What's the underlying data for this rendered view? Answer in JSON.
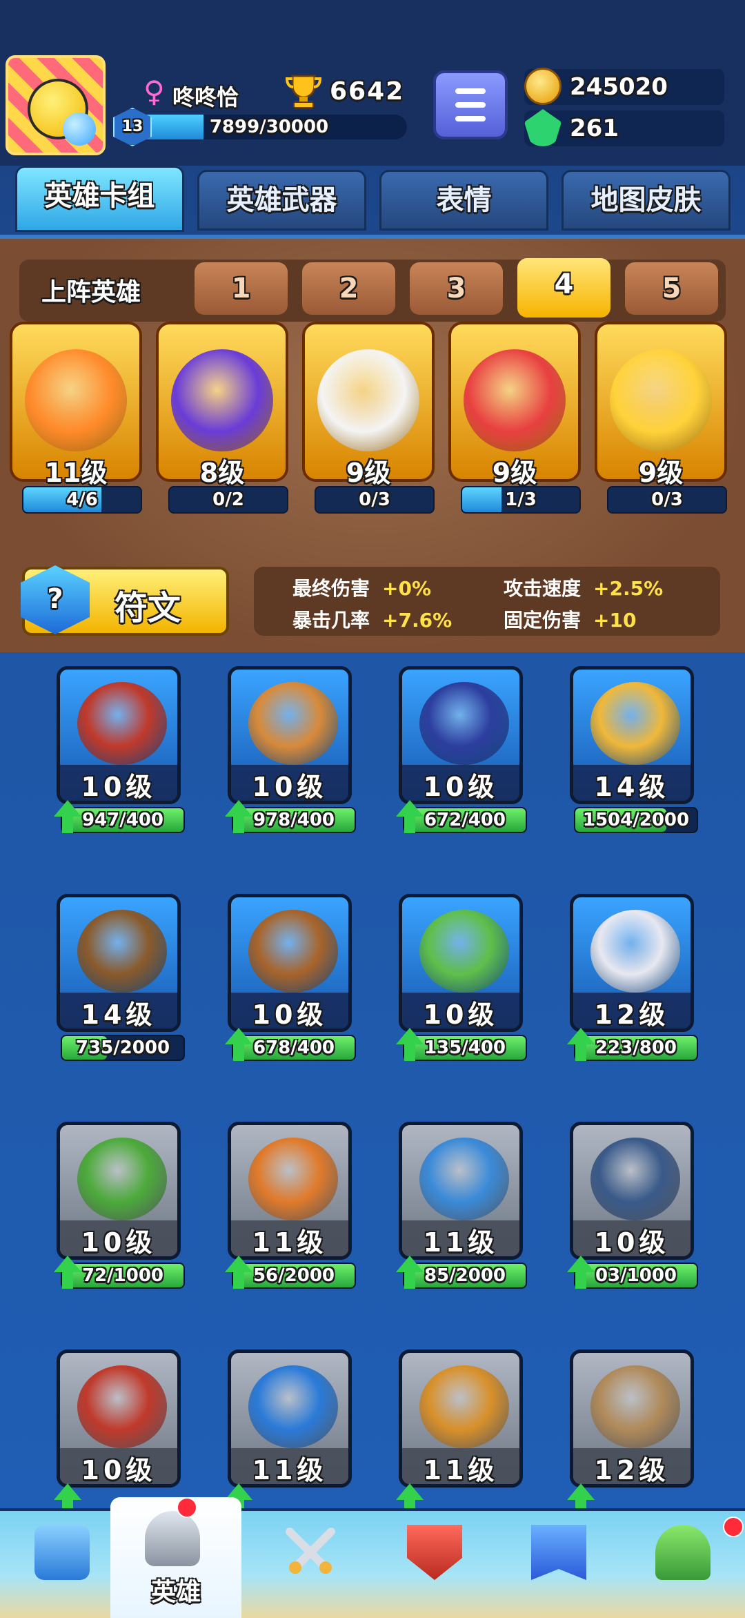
{
  "player": {
    "name": "咚咚恰",
    "level": "13",
    "trophies": "6642",
    "xp_text": "7899/30000",
    "xp_fraction": 0.263
  },
  "currency": {
    "coins": "245020",
    "gems": "261"
  },
  "tabs": [
    {
      "label": "英雄卡组",
      "active": true
    },
    {
      "label": "英雄武器",
      "active": false
    },
    {
      "label": "表情",
      "active": false
    },
    {
      "label": "地图皮肤",
      "active": false
    }
  ],
  "deck": {
    "title": "上阵英雄",
    "slots": [
      "1",
      "2",
      "3",
      "4",
      "5"
    ],
    "active_slot": "4",
    "cards": [
      {
        "level": "11级",
        "progress": "4/6",
        "fraction": 0.667,
        "color": "#ff8a2a"
      },
      {
        "level": "8级",
        "progress": "0/2",
        "fraction": 0,
        "color": "#6a3cd8"
      },
      {
        "level": "9级",
        "progress": "0/3",
        "fraction": 0,
        "color": "#f4f4f4"
      },
      {
        "level": "9级",
        "progress": "1/3",
        "fraction": 0.333,
        "color": "#e84040"
      },
      {
        "level": "9级",
        "progress": "0/3",
        "fraction": 0,
        "color": "#ffd23a"
      }
    ]
  },
  "rune": {
    "label": "符文",
    "icon": "?"
  },
  "stats": [
    {
      "label": "最终伤害",
      "value": "+0%"
    },
    {
      "label": "攻击速度",
      "value": "+2.5%"
    },
    {
      "label": "暴击几率",
      "value": "+7.6%"
    },
    {
      "label": "固定伤害",
      "value": "+10"
    }
  ],
  "heroes": [
    {
      "level": "10级",
      "progress": "947/400",
      "fraction": 1,
      "upgrade": true,
      "style": "blue",
      "color": "#c0392b"
    },
    {
      "level": "10级",
      "progress": "978/400",
      "fraction": 1,
      "upgrade": true,
      "style": "blue",
      "color": "#d88a3a"
    },
    {
      "level": "10级",
      "progress": "672/400",
      "fraction": 1,
      "upgrade": true,
      "style": "blue",
      "color": "#2c3e9e"
    },
    {
      "level": "14级",
      "progress": "1504/2000",
      "fraction": 0.752,
      "upgrade": false,
      "style": "blue",
      "color": "#f0b83a"
    },
    {
      "level": "14级",
      "progress": "735/2000",
      "fraction": 0.3675,
      "upgrade": false,
      "style": "blue",
      "color": "#8a5a2a"
    },
    {
      "level": "10级",
      "progress": "678/400",
      "fraction": 1,
      "upgrade": true,
      "style": "blue",
      "color": "#a8642a"
    },
    {
      "level": "10级",
      "progress": "135/400",
      "fraction": 1,
      "upgrade": true,
      "style": "blue",
      "color": "#5fbf4a"
    },
    {
      "level": "12级",
      "progress": "223/800",
      "fraction": 1,
      "upgrade": true,
      "style": "blue",
      "color": "#e8e8f0"
    },
    {
      "level": "10级",
      "progress": "72/1000",
      "fraction": 1,
      "upgrade": true,
      "style": "gray",
      "color": "#4caa3a"
    },
    {
      "level": "11级",
      "progress": "56/2000",
      "fraction": 1,
      "upgrade": true,
      "style": "gray",
      "color": "#e07a2a"
    },
    {
      "level": "11级",
      "progress": "85/2000",
      "fraction": 1,
      "upgrade": true,
      "style": "gray",
      "color": "#3a8ad8"
    },
    {
      "level": "10级",
      "progress": "03/1000",
      "fraction": 1,
      "upgrade": true,
      "style": "gray",
      "color": "#3a5a8a"
    },
    {
      "level": "10级",
      "progress": "",
      "fraction": 0,
      "upgrade": true,
      "style": "gray",
      "color": "#c0392b"
    },
    {
      "level": "11级",
      "progress": "",
      "fraction": 0,
      "upgrade": true,
      "style": "gray",
      "color": "#2a7ad8"
    },
    {
      "level": "11级",
      "progress": "",
      "fraction": 0,
      "upgrade": true,
      "style": "gray",
      "color": "#d8902a"
    },
    {
      "level": "12级",
      "progress": "",
      "fraction": 0,
      "upgrade": true,
      "style": "gray",
      "color": "#b08a5a"
    }
  ],
  "nav": [
    {
      "name": "nav-shop",
      "label": "",
      "icon": "treasure-chest-icon",
      "color": "#4aa8e8"
    },
    {
      "name": "nav-heroes",
      "label": "英雄",
      "icon": "knight-helmet-icon",
      "color": "#9aa3b0",
      "active": true
    },
    {
      "name": "nav-battle",
      "label": "",
      "icon": "crossed-swords-icon",
      "color": "#f2b43a"
    },
    {
      "name": "nav-rank",
      "label": "",
      "icon": "crown-shield-icon",
      "color": "#e84a3a"
    },
    {
      "name": "nav-social",
      "label": "",
      "icon": "team-banner-icon",
      "color": "#3a8ae8"
    },
    {
      "name": "nav-garden",
      "label": "",
      "icon": "sprout-island-icon",
      "color": "#5ec84a"
    }
  ]
}
